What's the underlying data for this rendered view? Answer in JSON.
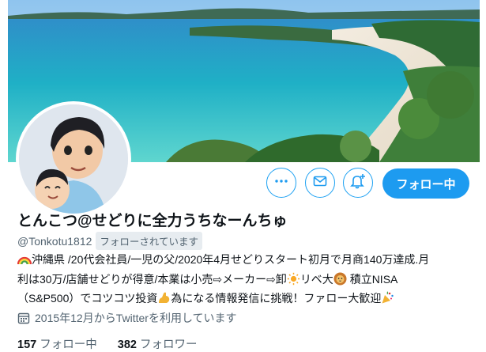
{
  "profile": {
    "display_name": "とんこつ@せどりに全力うちなーんちゅ",
    "handle": "@Tonkotu1812",
    "follows_you": "フォローされています",
    "joined": "2015年12月からTwitterを利用しています",
    "bio": {
      "line1": "沖縄県 /20代会社員/一児の父/2020年4月せどりスタート初月で月商140万達成.月",
      "line2a": "利は30万/店舗せどりが得意/本業は小売⇨メーカー⇨卸",
      "line2b": "リベ大",
      "line2c": " 積立NISA",
      "line3a": "（S&P500）でコツコツ投資",
      "line3b": "為になる情報発信に挑戦！ファロー大歓迎"
    }
  },
  "stats": {
    "following_count": "157",
    "following_label": "フォロー中",
    "followers_count": "382",
    "followers_label": "フォロワー"
  },
  "actions": {
    "follow_label": "フォロー中",
    "more_icon": "more-icon",
    "message_icon": "mail-icon",
    "notify_icon": "bell-plus-icon"
  },
  "colors": {
    "accent": "#1d9bf0",
    "text": "#0f1419",
    "muted": "#536471"
  }
}
